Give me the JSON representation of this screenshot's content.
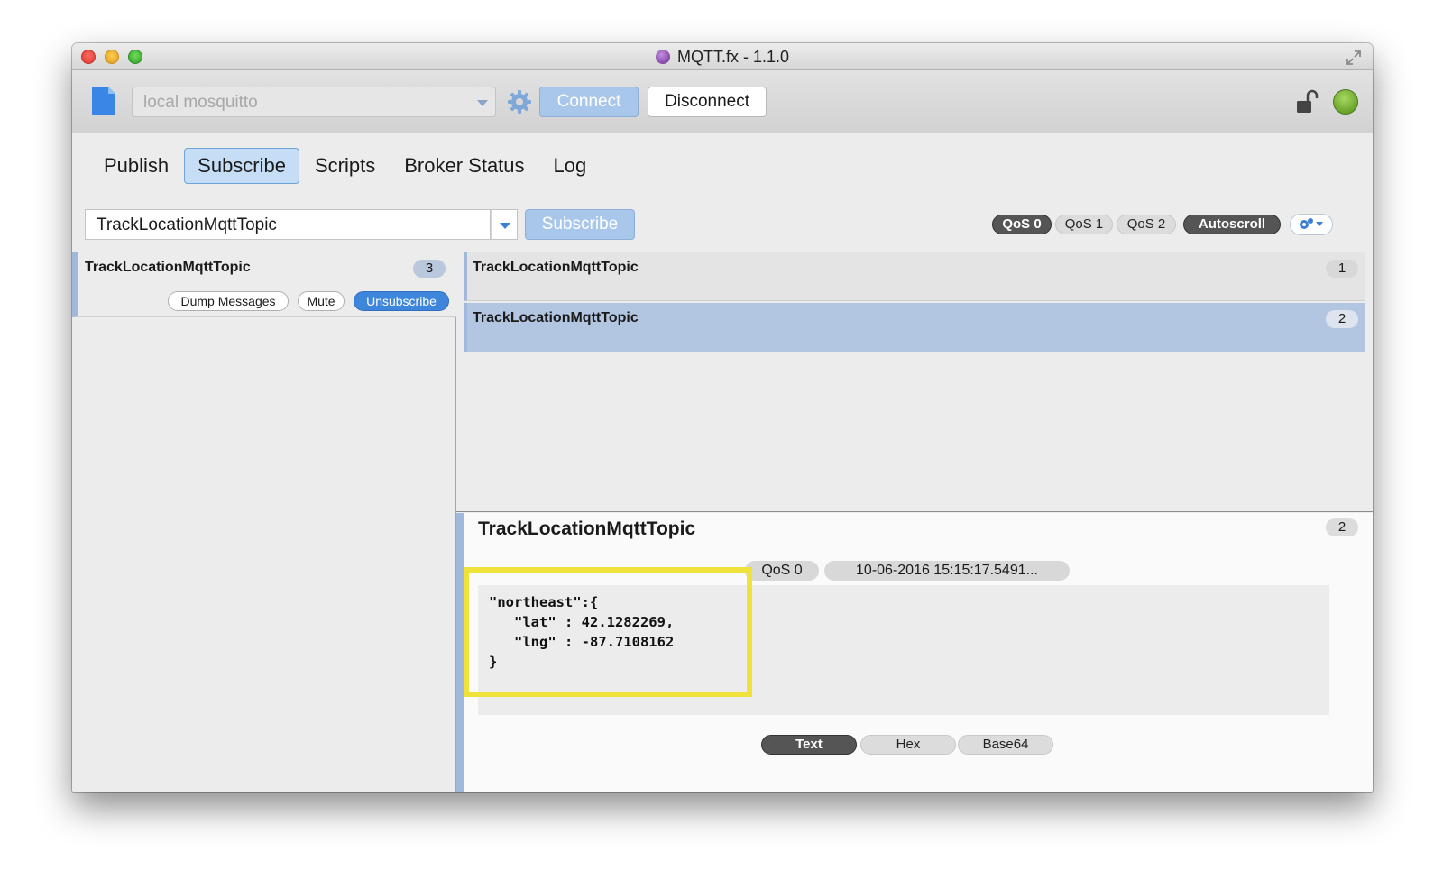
{
  "window": {
    "title": "MQTT.fx - 1.1.0"
  },
  "toolbar": {
    "profile_value": "local mosquitto",
    "connect_label": "Connect",
    "disconnect_label": "Disconnect",
    "status_color": "#6cbb2c"
  },
  "tabs": [
    {
      "label": "Publish",
      "active": false
    },
    {
      "label": "Subscribe",
      "active": true
    },
    {
      "label": "Scripts",
      "active": false
    },
    {
      "label": "Broker Status",
      "active": false
    },
    {
      "label": "Log",
      "active": false
    }
  ],
  "subscribe_bar": {
    "topic_value": "TrackLocationMqttTopic",
    "subscribe_label": "Subscribe",
    "qos": [
      "QoS 0",
      "QoS 1",
      "QoS 2"
    ],
    "qos_selected": "QoS 0",
    "autoscroll_label": "Autoscroll"
  },
  "subscriptions": [
    {
      "topic": "TrackLocationMqttTopic",
      "count": "3",
      "dump_label": "Dump Messages",
      "mute_label": "Mute",
      "unsubscribe_label": "Unsubscribe"
    }
  ],
  "messages": [
    {
      "topic": "TrackLocationMqttTopic",
      "number": "1"
    },
    {
      "topic": "TrackLocationMqttTopic",
      "number": "2",
      "selected": true
    }
  ],
  "detail": {
    "topic": "TrackLocationMqttTopic",
    "number": "2",
    "qos": "QoS 0",
    "timestamp": "10-06-2016  15:15:17.5491...",
    "payload": "\"northeast\":{\n   \"lat\" : 42.1282269,\n   \"lng\" : -87.7108162\n}",
    "formats": [
      "Text",
      "Hex",
      "Base64"
    ],
    "format_selected": "Text",
    "highlight_color": "#f0e23a"
  }
}
